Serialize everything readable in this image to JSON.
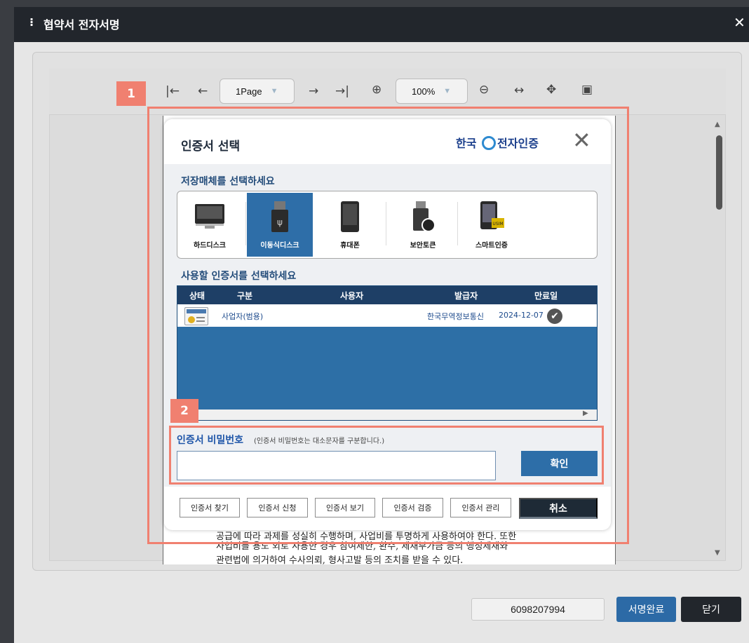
{
  "window": {
    "title": "협약서 전자서명",
    "title_prefix": "⁝"
  },
  "toolbar": {
    "first_icon": "|←",
    "prev_icon": "←",
    "page_select": "1Page",
    "next_icon": "→",
    "last_icon": "→|",
    "zoom_in_icon": "⊕",
    "zoom_select": "100%",
    "zoom_out_icon": "⊖",
    "fit_width_icon": "↔",
    "move_icon": "✥",
    "sidebar_icon": "▣"
  },
  "document": {
    "line1": "공급에 따라 과제를 성실히 수행하며, 사업비를 투명하게 사용하여야 한다. 또한",
    "line2": "사업비를 용도 외로 사용한 경우 참여제한, 환수, 제재부가금 등의 행정제재와",
    "line3": "관련법에 의거하여 수사의뢰, 형사고발 등의 조치를 받을 수 있다."
  },
  "cert_dialog": {
    "title": "인증서 선택",
    "logo_text_left": "한국",
    "logo_text_right": "전자인증",
    "storage_label": "저장매체를 선택하세요",
    "storage_items": [
      {
        "label": "하드디스크",
        "icon": "monitor-icon",
        "active": false
      },
      {
        "label": "이동식디스크",
        "icon": "usb-drive-icon",
        "active": true
      },
      {
        "label": "휴대폰",
        "icon": "phone-icon",
        "active": false
      },
      {
        "label": "보안토큰",
        "icon": "security-token-icon",
        "active": false
      },
      {
        "label": "스마트인증",
        "icon": "smart-card-icon",
        "active": false
      }
    ],
    "cert_list_label": "사용할 인증서를 선택하세요",
    "table_headers": [
      "상태",
      "구분",
      "사용자",
      "발급자",
      "만료일"
    ],
    "rows": [
      {
        "type": "사업자(범용)",
        "user": "",
        "issuer": "한국무역정보통신",
        "expiry": "2024-12-07"
      }
    ],
    "password_label": "인증서 비밀번호",
    "password_hint": "(인증서 비밀번호는 대소문자를 구분합니다.)",
    "password_value": "",
    "confirm_label": "확인",
    "footer_buttons": [
      "인증서 찾기",
      "인증서 신청",
      "인증서 보기",
      "인증서 검증",
      "인증서 관리"
    ],
    "cancel_label": "취소"
  },
  "annotations": {
    "badge1": "1",
    "badge2": "2"
  },
  "bottom": {
    "biz_number": "6098207994",
    "sign_done_label": "서명완료",
    "close_label": "닫기"
  },
  "colors": {
    "accent": "#2d6ea8",
    "annotation": "#f08070",
    "titlebar": "#22262c"
  }
}
